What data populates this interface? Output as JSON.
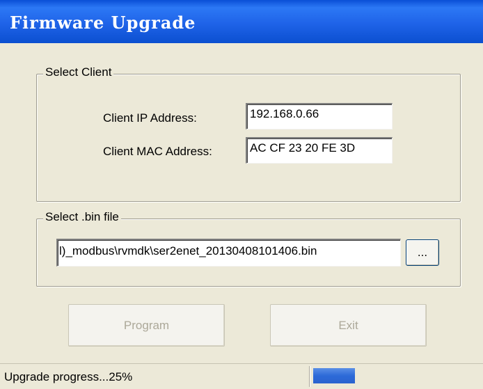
{
  "window": {
    "title": "Firmware Upgrade"
  },
  "select_client": {
    "legend": "Select Client",
    "ip_label": "Client IP Address:",
    "ip_value": "192.168.0.66",
    "mac_label": "Client MAC Address:",
    "mac_value": "AC CF 23 20 FE 3D"
  },
  "select_bin": {
    "legend": "Select .bin file",
    "path_value": "l)_modbus\\rvmdk\\ser2enet_20130408101406.bin",
    "browse_label": "..."
  },
  "buttons": {
    "program_label": "Program",
    "exit_label": "Exit"
  },
  "status": {
    "text": "Upgrade progress...25%",
    "progress_fraction": 0.25
  },
  "colors": {
    "titlebar": "#2c78f5",
    "progress": "#2d6ad8",
    "dialog_bg": "#ece9d8"
  }
}
